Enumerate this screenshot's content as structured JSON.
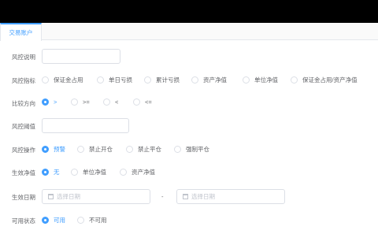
{
  "tabs": {
    "active": "交易账户"
  },
  "form": {
    "risk_desc_label": "风控说明",
    "indicator": {
      "label": "风控指标",
      "options": [
        "保证金占用",
        "单日亏损",
        "累计亏损",
        "资产净值",
        "单位净值",
        "保证金占用/资产净值"
      ],
      "selected": null
    },
    "compare": {
      "label": "比较方向",
      "options": [
        ">",
        ">=",
        "<",
        "<="
      ],
      "selected": ">"
    },
    "threshold_label": "风控阈值",
    "action": {
      "label": "风控操作",
      "options": [
        "预警",
        "禁止开仓",
        "禁止平仓",
        "强制平仓"
      ],
      "selected": "预警"
    },
    "net_value": {
      "label": "生效净值",
      "options": [
        "无",
        "单位净值",
        "资产净值"
      ],
      "selected": "无"
    },
    "effective_date": {
      "label": "生效日期",
      "start_placeholder": "选择日期",
      "separator": "-",
      "end_placeholder": "选择日期"
    },
    "status": {
      "label": "可用状态",
      "options": [
        "可用",
        "不可用"
      ],
      "selected": "可用"
    }
  },
  "colors": {
    "accent": "#409eff",
    "border": "#dcdfe6",
    "text": "#606266"
  }
}
